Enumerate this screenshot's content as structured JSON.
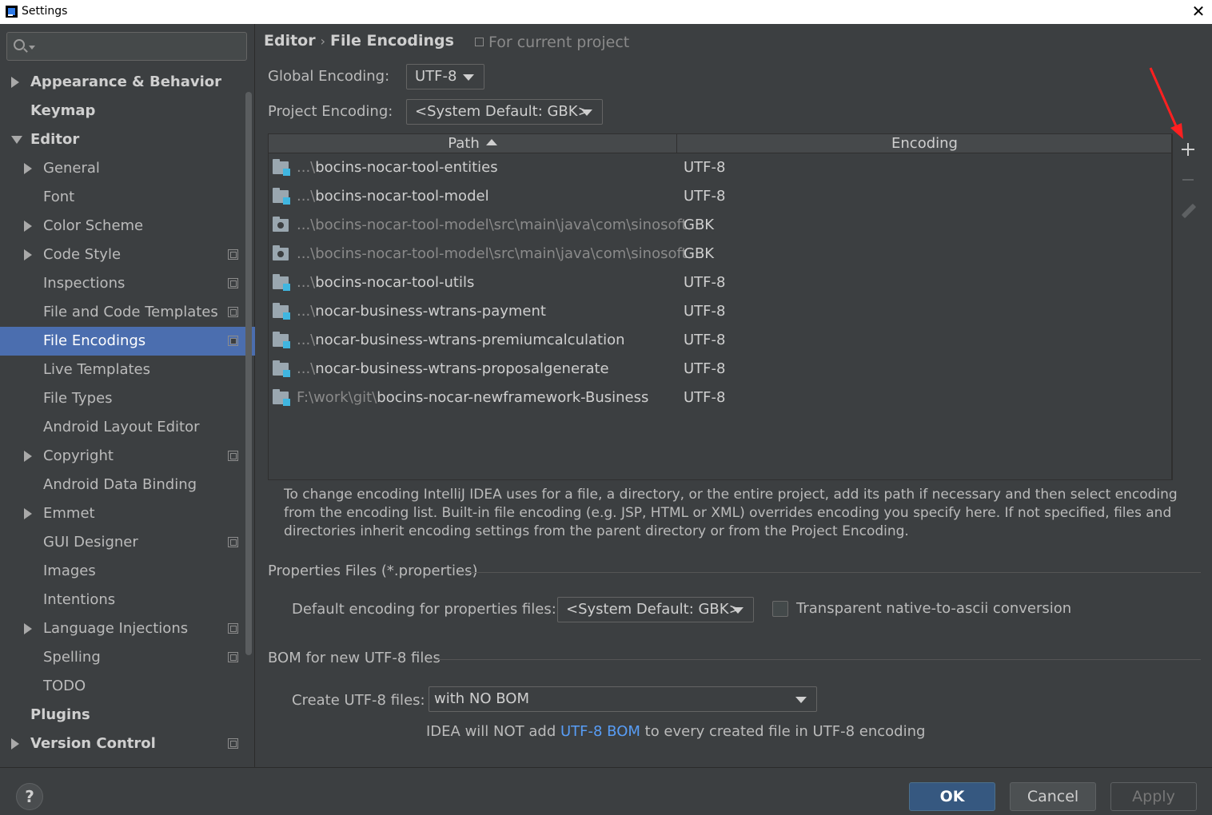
{
  "window": {
    "title": "Settings"
  },
  "search": {
    "placeholder": ""
  },
  "sidebar": {
    "items": [
      {
        "label": "Appearance & Behavior",
        "arrow": "right",
        "indent": 0,
        "bold": true,
        "copy": false
      },
      {
        "label": "Keymap",
        "arrow": "",
        "indent": 0,
        "bold": true,
        "copy": false
      },
      {
        "label": "Editor",
        "arrow": "down",
        "indent": 0,
        "bold": true,
        "copy": false
      },
      {
        "label": "General",
        "arrow": "right",
        "indent": 1,
        "bold": false,
        "copy": false
      },
      {
        "label": "Font",
        "arrow": "",
        "indent": 1,
        "bold": false,
        "copy": false
      },
      {
        "label": "Color Scheme",
        "arrow": "right",
        "indent": 1,
        "bold": false,
        "copy": false
      },
      {
        "label": "Code Style",
        "arrow": "right",
        "indent": 1,
        "bold": false,
        "copy": true
      },
      {
        "label": "Inspections",
        "arrow": "",
        "indent": 1,
        "bold": false,
        "copy": true
      },
      {
        "label": "File and Code Templates",
        "arrow": "",
        "indent": 1,
        "bold": false,
        "copy": true
      },
      {
        "label": "File Encodings",
        "arrow": "",
        "indent": 1,
        "bold": false,
        "copy": true,
        "selected": true
      },
      {
        "label": "Live Templates",
        "arrow": "",
        "indent": 1,
        "bold": false,
        "copy": false
      },
      {
        "label": "File Types",
        "arrow": "",
        "indent": 1,
        "bold": false,
        "copy": false
      },
      {
        "label": "Android Layout Editor",
        "arrow": "",
        "indent": 1,
        "bold": false,
        "copy": false
      },
      {
        "label": "Copyright",
        "arrow": "right",
        "indent": 1,
        "bold": false,
        "copy": true
      },
      {
        "label": "Android Data Binding",
        "arrow": "",
        "indent": 1,
        "bold": false,
        "copy": false
      },
      {
        "label": "Emmet",
        "arrow": "right",
        "indent": 1,
        "bold": false,
        "copy": false
      },
      {
        "label": "GUI Designer",
        "arrow": "",
        "indent": 1,
        "bold": false,
        "copy": true
      },
      {
        "label": "Images",
        "arrow": "",
        "indent": 1,
        "bold": false,
        "copy": false
      },
      {
        "label": "Intentions",
        "arrow": "",
        "indent": 1,
        "bold": false,
        "copy": false
      },
      {
        "label": "Language Injections",
        "arrow": "right",
        "indent": 1,
        "bold": false,
        "copy": true
      },
      {
        "label": "Spelling",
        "arrow": "",
        "indent": 1,
        "bold": false,
        "copy": true
      },
      {
        "label": "TODO",
        "arrow": "",
        "indent": 1,
        "bold": false,
        "copy": false
      },
      {
        "label": "Plugins",
        "arrow": "",
        "indent": 0,
        "bold": true,
        "copy": false
      },
      {
        "label": "Version Control",
        "arrow": "right",
        "indent": 0,
        "bold": true,
        "copy": true
      }
    ]
  },
  "breadcrumb": {
    "parent": "Editor",
    "separator": "›",
    "current": "File Encodings"
  },
  "for_project": "For current project",
  "global_encoding": {
    "label": "Global Encoding:",
    "value": "UTF-8"
  },
  "project_encoding": {
    "label": "Project Encoding:",
    "value": "<System Default: GBK>"
  },
  "table": {
    "columns": {
      "path": "Path",
      "encoding": "Encoding"
    },
    "rows": [
      {
        "prefix": "...\\",
        "name": "bocins-nocar-tool-entities",
        "encoding": "UTF-8",
        "icon": "module-folder-icon",
        "dim": false
      },
      {
        "prefix": "...\\",
        "name": "bocins-nocar-tool-model",
        "encoding": "UTF-8",
        "icon": "module-folder-icon",
        "dim": false
      },
      {
        "prefix": "...\\",
        "name": "bocins-nocar-tool-model\\src\\main\\java\\com\\sinosoft",
        "encoding": "GBK",
        "icon": "package-folder-icon",
        "dim": true
      },
      {
        "prefix": "...\\",
        "name": "bocins-nocar-tool-model\\src\\main\\java\\com\\sinosoft",
        "encoding": "GBK",
        "icon": "package-folder-icon",
        "dim": true
      },
      {
        "prefix": "...\\",
        "name": "bocins-nocar-tool-utils",
        "encoding": "UTF-8",
        "icon": "module-folder-icon",
        "dim": false
      },
      {
        "prefix": "...\\",
        "name": "nocar-business-wtrans-payment",
        "encoding": "UTF-8",
        "icon": "module-folder-icon",
        "dim": false
      },
      {
        "prefix": "...\\",
        "name": "nocar-business-wtrans-premiumcalculation",
        "encoding": "UTF-8",
        "icon": "module-folder-icon",
        "dim": false
      },
      {
        "prefix": "...\\",
        "name": "nocar-business-wtrans-proposalgenerate",
        "encoding": "UTF-8",
        "icon": "module-folder-icon",
        "dim": false
      },
      {
        "prefix": "F:\\work\\git\\",
        "name": "bocins-nocar-newframework-Business",
        "encoding": "UTF-8",
        "icon": "module-folder-icon",
        "dim": false
      }
    ]
  },
  "description": "To change encoding IntelliJ IDEA uses for a file, a directory, or the entire project, add its path if necessary and then select encoding from the encoding list. Built-in file encoding (e.g. JSP, HTML or XML) overrides encoding you specify here. If not specified, files and directories inherit encoding settings from the parent directory or from the Project Encoding.",
  "properties": {
    "section_title": "Properties Files (*.properties)",
    "default_label": "Default encoding for properties files:",
    "default_value": "<System Default: GBK>",
    "transparent_label": "Transparent native-to-ascii conversion",
    "transparent_checked": false
  },
  "bom": {
    "section_title": "BOM for new UTF-8 files",
    "create_label": "Create UTF-8 files:",
    "create_value": "with NO BOM",
    "note_before": "IDEA will NOT add ",
    "note_link": "UTF-8 BOM",
    "note_after": " to every created file in UTF-8 encoding"
  },
  "buttons": {
    "help": "?",
    "ok": "OK",
    "cancel": "Cancel",
    "apply": "Apply"
  },
  "colors": {
    "background": "#3c3f41",
    "selection": "#4b6eaf",
    "ok_button": "#365880",
    "link": "#589df6",
    "annotation_arrow": "#ff2020"
  }
}
